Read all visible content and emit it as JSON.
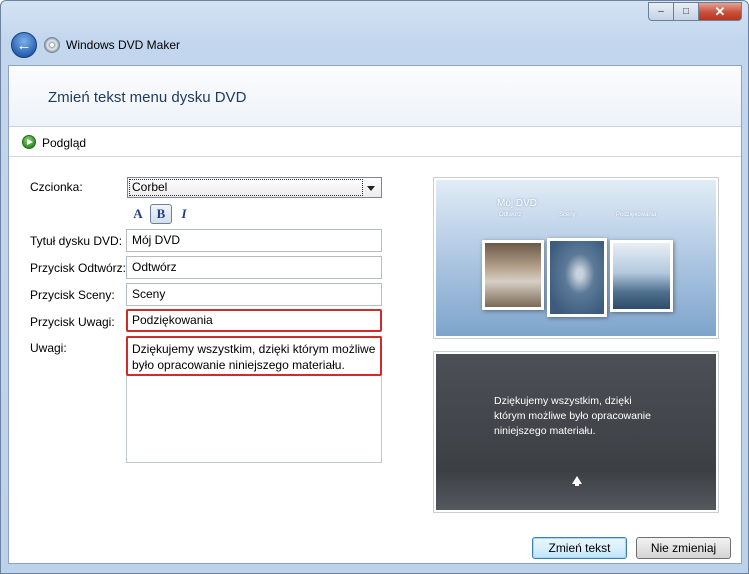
{
  "window": {
    "title": "Windows DVD Maker",
    "controls": {
      "minimize": "–",
      "maximize": "□",
      "close": "✕"
    }
  },
  "header": {
    "title": "Zmień tekst menu dysku DVD"
  },
  "preview": {
    "label": "Podgląd"
  },
  "form": {
    "font_label": "Czcionka:",
    "font_value": "Corbel",
    "format_buttons": {
      "font_color": "A",
      "bold": "B",
      "italic": "I"
    },
    "dvd_title_label": "Tytuł dysku DVD:",
    "dvd_title_value": "Mój DVD",
    "play_button_label": "Przycisk Odtwórz:",
    "play_button_value": "Odtwórz",
    "scenes_button_label": "Przycisk Sceny:",
    "scenes_button_value": "Sceny",
    "notes_button_label": "Przycisk Uwagi:",
    "notes_button_value": "Podziękowania",
    "notes_label": "Uwagi:",
    "notes_value": "Dziękujemy wszystkim, dzięki którym możliwe było opracowanie niniejszego materiału."
  },
  "thumb_menu": {
    "title": "Mój DVD",
    "items": [
      "Odtwórz",
      "Sceny",
      "Podziękowania"
    ]
  },
  "thumb_notes": {
    "text": "Dziękujemy wszystkim, dzięki którym możliwe było opracowanie niniejszego materiału."
  },
  "buttons": {
    "apply": "Zmień tekst",
    "cancel": "Nie zmieniaj"
  },
  "colors": {
    "highlight": "#d22b2b",
    "header_title": "#1e3a5f"
  }
}
